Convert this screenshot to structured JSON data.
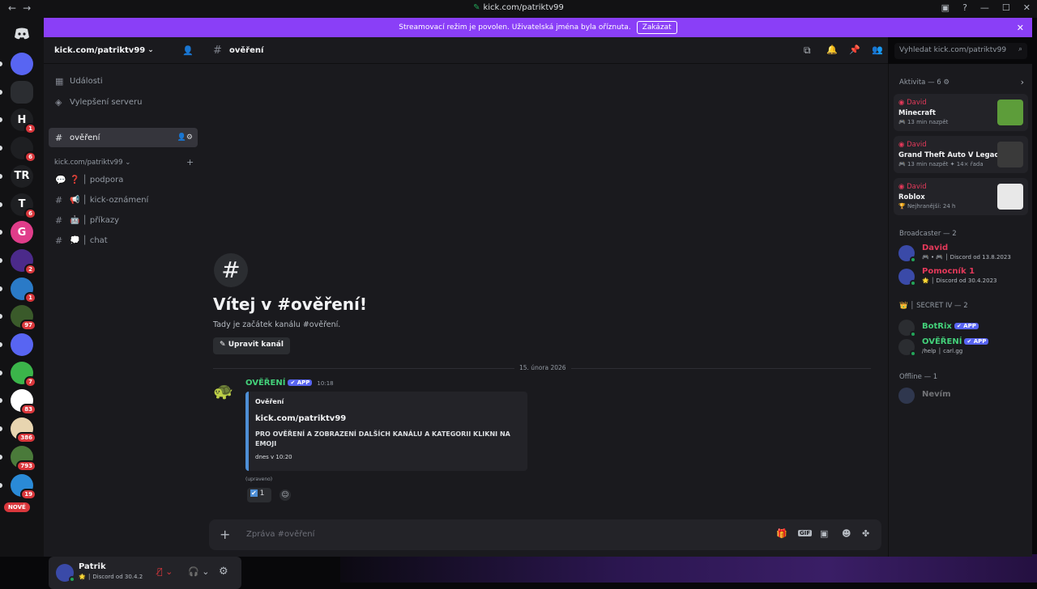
{
  "window": {
    "url": "kick.com/patriktv99",
    "back_icon": "←",
    "forward_icon": "→"
  },
  "banner": {
    "text": "Streamovací režim je povolen. Uživatelská jména byla oříznuta.",
    "button": "Zakázat"
  },
  "servers": [
    {
      "label": "",
      "color": "#5865f2",
      "badge": ""
    },
    {
      "label": "",
      "color": "#2b2d31",
      "badge": ""
    },
    {
      "label": "H",
      "color": "#1e1f22",
      "badge": "1"
    },
    {
      "label": "",
      "color": "#1e1f22",
      "badge": "6"
    },
    {
      "label": "TR",
      "color": "#1e1f22",
      "badge": ""
    },
    {
      "label": "T",
      "color": "#1e1f22",
      "badge": "6"
    },
    {
      "label": "G",
      "color": "#e03d8a",
      "badge": ""
    },
    {
      "label": "",
      "color": "#4b2a8a",
      "badge": "2"
    },
    {
      "label": "",
      "color": "#2a7ac7",
      "badge": "1"
    },
    {
      "label": "",
      "color": "#3a5a2a",
      "badge": "97"
    },
    {
      "label": "",
      "color": "#5865f2",
      "badge": ""
    },
    {
      "label": "",
      "color": "#3bb54a",
      "badge": "7"
    },
    {
      "label": "",
      "color": "#ffffff",
      "badge": "83"
    },
    {
      "label": "",
      "color": "#e8d5b0",
      "badge": "386"
    },
    {
      "label": "",
      "color": "#4a7a3a",
      "badge": "793"
    },
    {
      "label": "",
      "color": "#2a8ad7",
      "badge": "19"
    }
  ],
  "new_badge": "NOVÉ",
  "sidebar": {
    "server_name": "kick.com/patriktv99",
    "top_items": [
      {
        "label": "Události",
        "icon": "calendar-icon"
      },
      {
        "label": "Vylepšení serveru",
        "icon": "boost-icon"
      }
    ],
    "active_channel": "ověření",
    "category": "kick.com/patriktv99",
    "channels": [
      {
        "emoji": "❓",
        "label": "│ podpora"
      },
      {
        "emoji": "📢",
        "label": "│ kick-oznámení"
      },
      {
        "emoji": "🤖",
        "label": "│ příkazy"
      },
      {
        "emoji": "💭",
        "label": "│ chat"
      }
    ]
  },
  "user": {
    "name": "Patrik",
    "status": "│ Discord od 30.4.2"
  },
  "header": {
    "channel": "ověření",
    "search_placeholder": "Vyhledat kick.com/patriktv99"
  },
  "welcome": {
    "title": "Vítej v #ověření!",
    "subtitle": "Tady je začátek kanálu #ověření.",
    "edit_button": "Upravit kanál"
  },
  "divider_date": "15. února 2026",
  "message": {
    "author": "OVĚŘENÍ",
    "app_tag": "✔ APP",
    "time": "10:18",
    "embed_author": "Ověření",
    "embed_title": "kick.com/patriktv99",
    "embed_desc": "PRO OVĚŘENÍ A ZOBRAZENÍ DALŠÍCH KANÁLU A KATEGORII KLIKNI NA EMOJI",
    "embed_footer": "dnes v 10:20",
    "edited": "(upraveno)",
    "reaction_count": "1"
  },
  "input": {
    "placeholder": "Zpráva #ověření"
  },
  "members": {
    "activity_header": "Aktivita — 6",
    "activities": [
      {
        "name": "David",
        "game": "Minecraft",
        "meta": "🎮 13 min nazpět",
        "color": "#5d9d3a"
      },
      {
        "name": "David",
        "game": "Grand Theft Auto V Legacy",
        "meta": "🎮 13 min nazpět  ✦ 14× řada",
        "color": "#3a3a3a"
      },
      {
        "name": "David",
        "game": "Roblox",
        "meta": "🏆 Nejhranější: 24 h",
        "color": "#e8e8e8"
      }
    ],
    "broadcaster_header": "Broadcaster — 2",
    "broadcasters": [
      {
        "name": "David",
        "sub": "🎮 • 🎮  │ Discord od 13.8.2023",
        "color": "#e4395a"
      },
      {
        "name": "Pomocník 1",
        "sub": "🌟  │ Discord od 30.4.2023",
        "color": "#e4395a"
      }
    ],
    "secret_header": "👑 │ SECRET IV — 2",
    "secret": [
      {
        "name": "BotRix",
        "sub": "",
        "color": "#43d17a"
      },
      {
        "name": "OVĚŘENÍ",
        "sub": "/help │ carl.gg",
        "color": "#43d17a"
      }
    ],
    "offline_header": "Offline — 1",
    "offline": [
      {
        "name": "Nevím",
        "color": "#7a2a3a"
      }
    ]
  }
}
